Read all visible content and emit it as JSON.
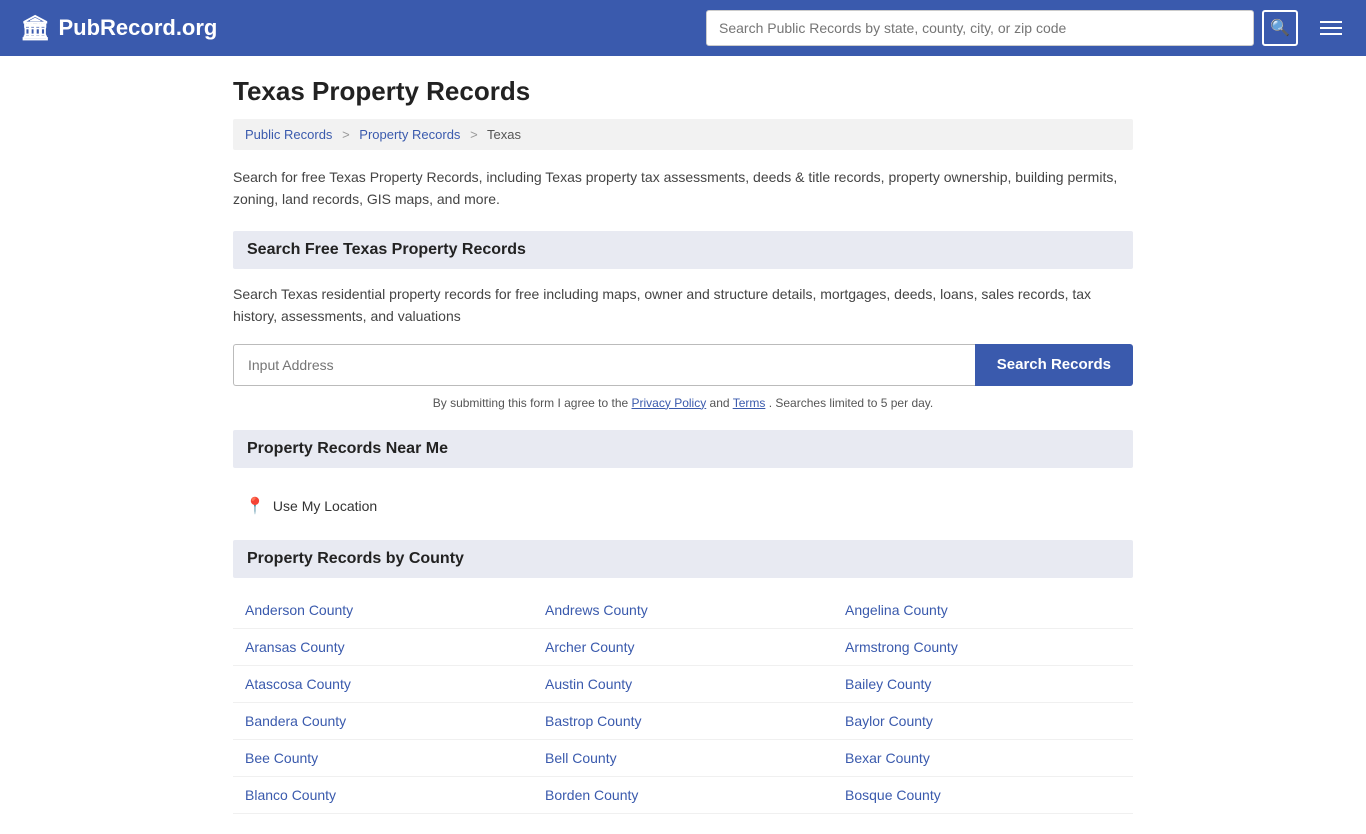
{
  "header": {
    "logo_text": "PubRecord.org",
    "search_placeholder": "Search Public Records by state, county, city, or zip code",
    "menu_icon": "☰"
  },
  "page": {
    "title": "Texas Property Records",
    "breadcrumb": {
      "items": [
        "Public Records",
        "Property Records",
        "Texas"
      ]
    },
    "description": "Search for free Texas Property Records, including Texas property tax assessments, deeds & title records, property ownership, building permits, zoning, land records, GIS maps, and more.",
    "search_section": {
      "heading": "Search Free Texas Property Records",
      "description": "Search Texas residential property records for free including maps, owner and structure details, mortgages, deeds, loans, sales records, tax history, assessments, and valuations",
      "input_placeholder": "Input Address",
      "button_label": "Search Records",
      "disclaimer": "By submitting this form I agree to the",
      "privacy_policy": "Privacy Policy",
      "and": "and",
      "terms": "Terms",
      "disclaimer_end": ". Searches limited to 5 per day."
    },
    "near_me_section": {
      "heading": "Property Records Near Me",
      "location_label": "Use My Location"
    },
    "county_section": {
      "heading": "Property Records by County",
      "counties": [
        "Anderson County",
        "Andrews County",
        "Angelina County",
        "Aransas County",
        "Archer County",
        "Armstrong County",
        "Atascosa County",
        "Austin County",
        "Bailey County",
        "Bandera County",
        "Bastrop County",
        "Baylor County",
        "Bee County",
        "Bell County",
        "Bexar County",
        "Blanco County",
        "Borden County",
        "Bosque County"
      ]
    }
  }
}
